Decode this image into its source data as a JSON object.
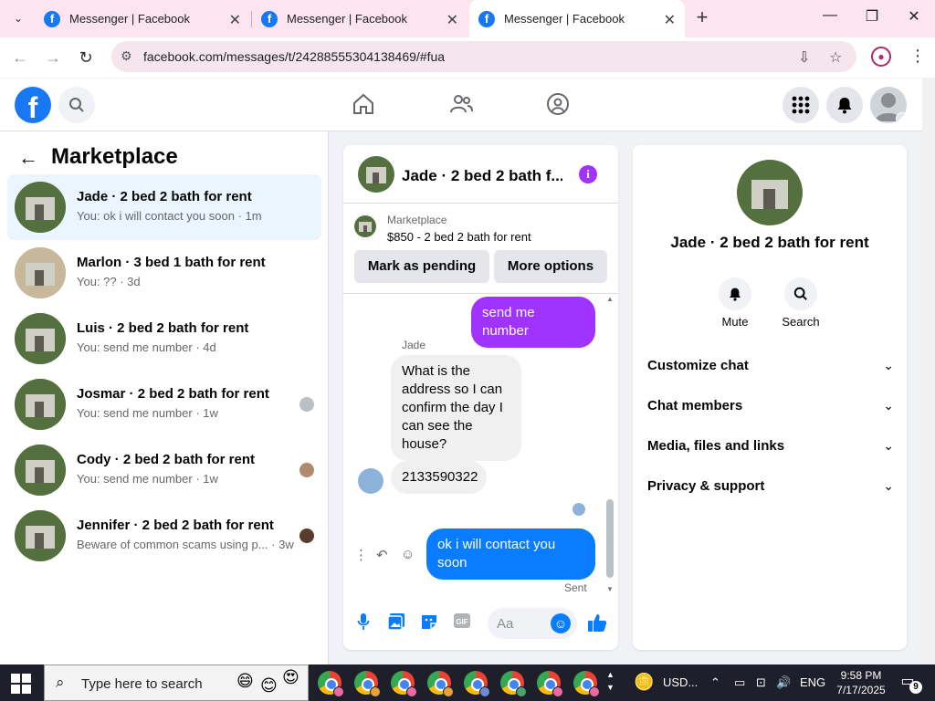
{
  "browser": {
    "tabs": [
      {
        "title": "Messenger | Facebook"
      },
      {
        "title": "Messenger | Facebook"
      },
      {
        "title": "Messenger | Facebook"
      }
    ],
    "url": "facebook.com/messages/t/24288555304138469/#fua"
  },
  "left_panel": {
    "title": "Marketplace",
    "conversations": [
      {
        "name": "Jade · 2 bed 2 bath for rent",
        "preview": "You: ok i will contact you soon · 1m",
        "selected": true
      },
      {
        "name": "Marlon · 3 bed 1 bath for rent",
        "preview": "You: ?? · 3d"
      },
      {
        "name": "Luis · 2 bed 2 bath for rent",
        "preview": "You: send me number · 4d"
      },
      {
        "name": "Josmar · 2 bed 2 bath for rent",
        "preview": "You: send me number · 1w"
      },
      {
        "name": "Cody · 2 bed 2 bath for rent",
        "preview": "You: send me number · 1w"
      },
      {
        "name": "Jennifer · 2 bed 2 bath for rent",
        "preview": "Beware of common scams using p... · 3w"
      }
    ]
  },
  "chat": {
    "title": "Jade · 2 bed 2 bath f...",
    "marketplace_label": "Marketplace",
    "listing": "$850 - 2 bed 2 bath for rent",
    "mark_pending": "Mark as pending",
    "more_options": "More options",
    "messages": {
      "out_1": "send me number",
      "sender": "Jade",
      "in_1": "What is the address so I can confirm the day I can see the house?",
      "in_2": "2133590322",
      "out_2": "ok i will contact you soon",
      "status": "Sent"
    },
    "input_placeholder": "Aa"
  },
  "info_panel": {
    "name": "Jade · 2 bed 2 bath for rent",
    "mute": "Mute",
    "search": "Search",
    "sections": [
      "Customize chat",
      "Chat members",
      "Media, files and links",
      "Privacy & support"
    ]
  },
  "taskbar": {
    "search_placeholder": "Type here to search",
    "currency": "USD...",
    "lang": "ENG",
    "time": "9:58 PM",
    "date": "7/17/2025",
    "notifications": "9"
  },
  "colors": {
    "brand": "#1877f2",
    "accent_purple": "#a033ff",
    "bubble_blue": "#0a7cff"
  }
}
